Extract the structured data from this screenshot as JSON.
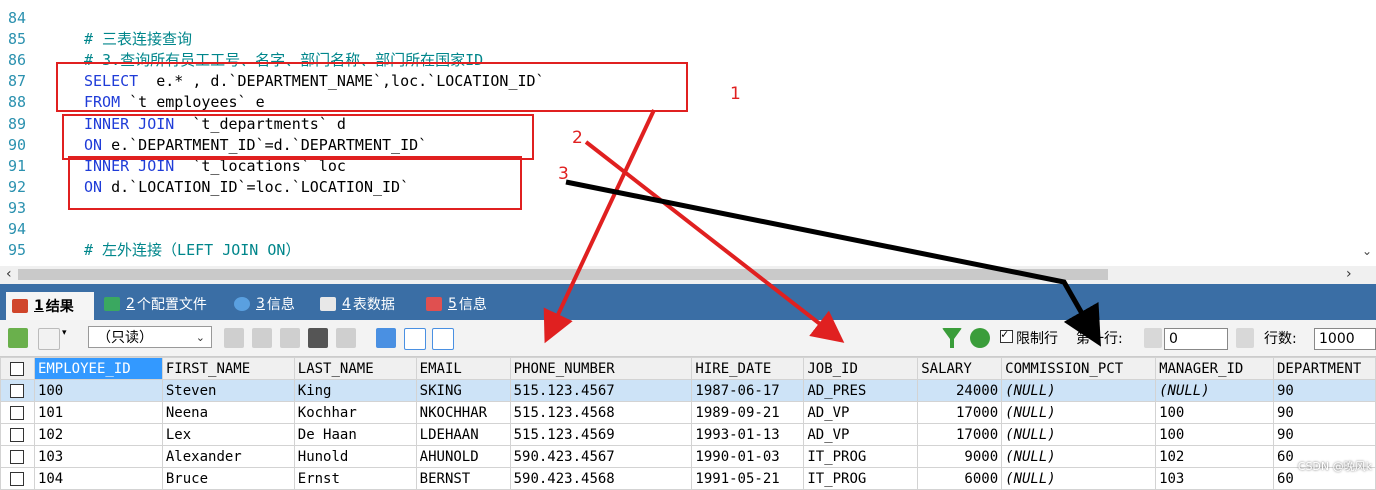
{
  "editor": {
    "lines": [
      {
        "n": "84",
        "text": ""
      },
      {
        "n": "85",
        "text": "# 三表连接查询"
      },
      {
        "n": "86",
        "text": "# 3.查询所有员工工号、名字、部门名称、部门所在国家ID"
      },
      {
        "n": "87",
        "text": "SELECT  e.* , d.`DEPARTMENT_NAME`,loc.`LOCATION_ID`"
      },
      {
        "n": "88",
        "text": "FROM `t_employees` e"
      },
      {
        "n": "89",
        "text": "INNER JOIN  `t_departments` d"
      },
      {
        "n": "90",
        "text": "ON e.`DEPARTMENT_ID`=d.`DEPARTMENT_ID`"
      },
      {
        "n": "91",
        "text": "INNER JOIN  `t_locations` loc"
      },
      {
        "n": "92",
        "text": "ON d.`LOCATION_ID`=loc.`LOCATION_ID`"
      },
      {
        "n": "93",
        "text": ""
      },
      {
        "n": "94",
        "text": ""
      },
      {
        "n": "95",
        "text": "# 左外连接（LEFT JOIN ON）"
      }
    ],
    "scroll_left": "‹",
    "scroll_right": "›",
    "scroll_down": "⌄"
  },
  "annotations": {
    "label1": "1",
    "label2": "2",
    "label3": "3"
  },
  "tabs": [
    {
      "num": "1",
      "label": "结果"
    },
    {
      "num": "2",
      "label": "个配置文件"
    },
    {
      "num": "3",
      "label": "信息"
    },
    {
      "num": "4",
      "label": "表数据"
    },
    {
      "num": "5",
      "label": "信息"
    }
  ],
  "toolbar": {
    "mode": "（只读）",
    "limit_label": "限制行",
    "first_row_label": "第一行:",
    "first_row_value": "0",
    "rows_label": "行数:",
    "rows_value": "1000",
    "limit_checked": true
  },
  "grid": {
    "columns": [
      "EMPLOYEE_ID",
      "FIRST_NAME",
      "LAST_NAME",
      "EMAIL",
      "PHONE_NUMBER",
      "HIRE_DATE",
      "JOB_ID",
      "SALARY",
      "COMMISSION_PCT",
      "MANAGER_ID",
      "DEPARTMENT"
    ],
    "rows": [
      [
        "100",
        "Steven",
        "King",
        "SKING",
        "515.123.4567",
        "1987-06-17",
        "AD_PRES",
        "24000",
        "(NULL)",
        "(NULL)",
        "90"
      ],
      [
        "101",
        "Neena",
        "Kochhar",
        "NKOCHHAR",
        "515.123.4568",
        "1989-09-21",
        "AD_VP",
        "17000",
        "(NULL)",
        "100",
        "90"
      ],
      [
        "102",
        "Lex",
        "De Haan",
        "LDEHAAN",
        "515.123.4569",
        "1993-01-13",
        "AD_VP",
        "17000",
        "(NULL)",
        "100",
        "90"
      ],
      [
        "103",
        "Alexander",
        "Hunold",
        "AHUNOLD",
        "590.423.4567",
        "1990-01-03",
        "IT_PROG",
        "9000",
        "(NULL)",
        "102",
        "60"
      ],
      [
        "104",
        "Bruce",
        "Ernst",
        "BERNST",
        "590.423.4568",
        "1991-05-21",
        "IT_PROG",
        "6000",
        "(NULL)",
        "103",
        "60"
      ]
    ]
  },
  "watermark": "CSDN @晚风k",
  "colors": {
    "tabbar": "#3a6ea5",
    "annotation_red": "#e02020",
    "selected_header": "#3399ff"
  }
}
